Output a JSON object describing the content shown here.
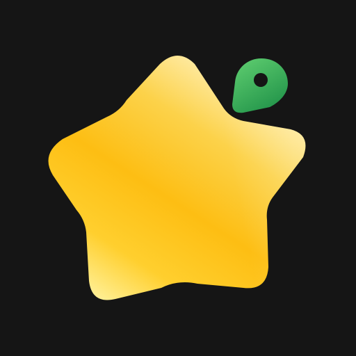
{
  "icon": {
    "name": "star-location-app-icon",
    "background_color": "#151515",
    "star": {
      "icon": "star-icon",
      "gradient_colors": [
        "#FFF3C2",
        "#FCD24A",
        "#FDBE13",
        "#FFCF2E",
        "#FFF19A"
      ]
    },
    "pin": {
      "icon": "map-pin-icon",
      "gradient_colors": [
        "#5CCB6E",
        "#1F9148"
      ],
      "hole_color": "#151515"
    }
  }
}
